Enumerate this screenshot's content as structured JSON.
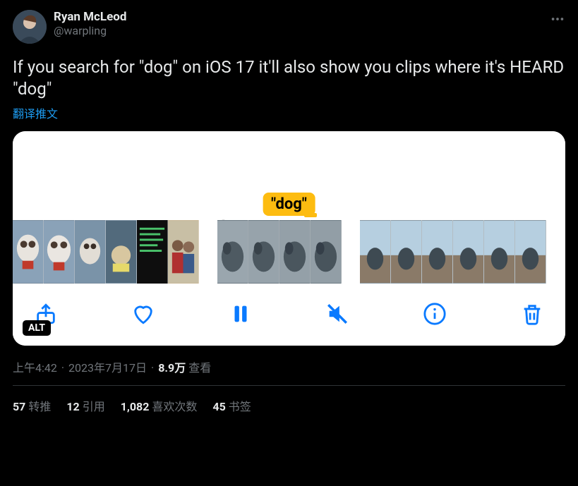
{
  "author": {
    "display_name": "Ryan McLeod",
    "handle": "@warpling"
  },
  "tweet_text": "If you search for \"dog\" on iOS 17 it'll also show you clips where it's HEARD \"dog\"",
  "translate_label": "翻译推文",
  "media": {
    "search_tag": "\"dog\"",
    "alt_badge": "ALT",
    "controls": {
      "share": "share",
      "like": "like",
      "pause": "pause",
      "mute": "mute",
      "info": "info",
      "trash": "delete"
    }
  },
  "timestamp": {
    "time": "上午4:42",
    "date": "2023年7月17日",
    "views_count": "8.9万",
    "views_label": "查看"
  },
  "stats": {
    "retweets": {
      "count": "57",
      "label": "转推"
    },
    "quotes": {
      "count": "12",
      "label": "引用"
    },
    "likes": {
      "count": "1,082",
      "label": "喜欢次数"
    },
    "bookmarks": {
      "count": "45",
      "label": "书签"
    }
  }
}
